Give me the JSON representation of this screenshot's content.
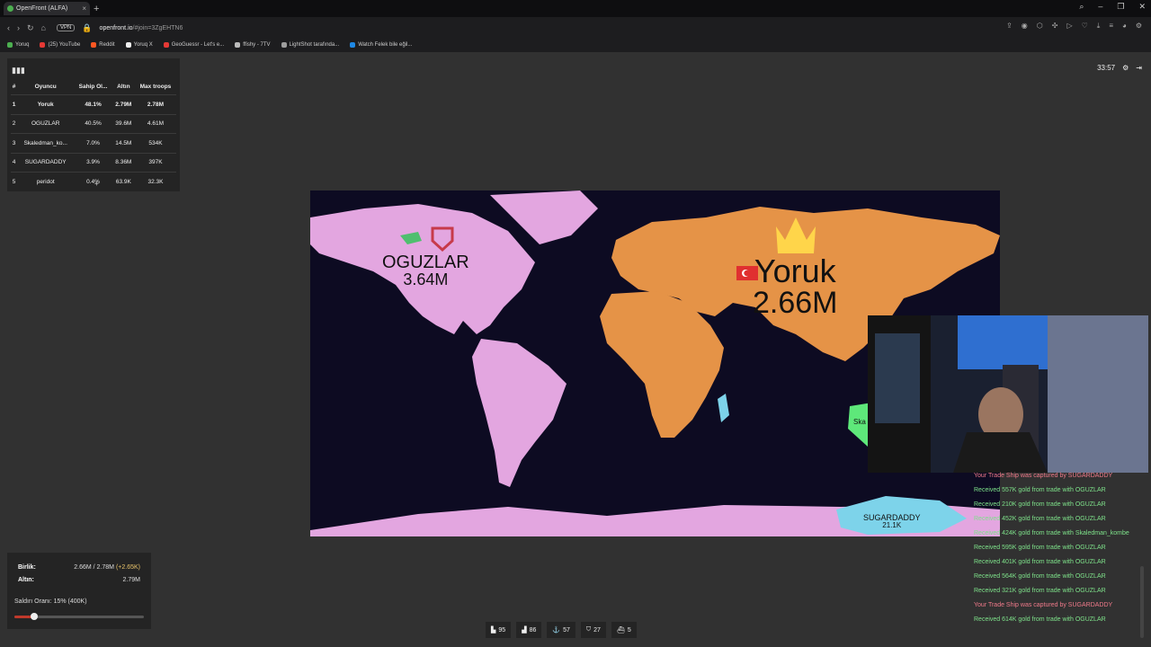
{
  "browser": {
    "tab_title": "OpenFront (ALFA)",
    "url": "openfront.io",
    "url_rest": "/#join=3ZgEHTN6",
    "vpn_label": "VPN",
    "bookmarks": [
      "Yoruq",
      "(25) YouTube",
      "Reddit",
      "Yoruq X",
      "GeoGuessr - Let's e...",
      "ffishy - 7TV",
      "LightShot tarafında...",
      "Watch Felek bile eğil..."
    ],
    "bookmark_colors": [
      "#4caf50",
      "#e53935",
      "#ff5722",
      "#eeeeee",
      "#e53935",
      "#bbbbbb",
      "#9e9e9e",
      "#1e88e5"
    ]
  },
  "leaderboard": {
    "headers": [
      "#",
      "Oyuncu",
      "Sahip Ol...",
      "Altın",
      "Max troops"
    ],
    "rows": [
      {
        "rank": "1",
        "player": "Yoruk",
        "owned": "48.1%",
        "gold": "2.79M",
        "troops": "2.78M"
      },
      {
        "rank": "2",
        "player": "OGUZLAR",
        "owned": "40.5%",
        "gold": "39.6M",
        "troops": "4.61M"
      },
      {
        "rank": "3",
        "player": "Skaledman_ko...",
        "owned": "7.0%",
        "gold": "14.5M",
        "troops": "534K"
      },
      {
        "rank": "4",
        "player": "SUGARDADDY",
        "owned": "3.9%",
        "gold": "8.36M",
        "troops": "397K"
      },
      {
        "rank": "5",
        "player": "peridot",
        "owned": "0.4%",
        "gold": "63.9K",
        "troops": "32.3K"
      }
    ],
    "expand_label": "+"
  },
  "timer": "33:57",
  "map": {
    "labels": [
      {
        "name": "OGUZLAR",
        "value": "3.64M"
      },
      {
        "name": "Yoruk",
        "value": "2.66M"
      },
      {
        "name": "SUGARDADDY",
        "value": "21.1K"
      },
      {
        "name": "Ska",
        "value": ""
      }
    ],
    "colors": {
      "ocean": "#0d0b22",
      "oguzlar": "#e3a6e0",
      "yoruk": "#e59347",
      "sugardaddy": "#7dd3ea",
      "skaledman": "#5ee87a"
    }
  },
  "stats": {
    "troops_label": "Birlik:",
    "troops_value": "2.66M / 2.78M",
    "troops_rate": "(+2.65K)",
    "gold_label": "Altın:",
    "gold_value": "2.79M",
    "attack_ratio_label": "Saldırı Oranı: 15% (400K)",
    "attack_ratio": 0.15
  },
  "bottom_bar": [
    {
      "icon": "city-icon",
      "value": "95"
    },
    {
      "icon": "factory-icon",
      "value": "86"
    },
    {
      "icon": "port-icon",
      "value": "57"
    },
    {
      "icon": "defense-icon",
      "value": "27"
    },
    {
      "icon": "warship-icon",
      "value": "5"
    }
  ],
  "events": [
    {
      "text": "Your Trade Ship was captured by SUGARDADDY",
      "type": "bad"
    },
    {
      "text": "Received 557K gold from trade with OGUZLAR",
      "type": "good"
    },
    {
      "text": "Received 210K gold from trade with OGUZLAR",
      "type": "good"
    },
    {
      "text": "Received 452K gold from trade with OGUZLAR",
      "type": "good"
    },
    {
      "text": "Received 424K gold from trade with Skaledman_kombe",
      "type": "good"
    },
    {
      "text": "Received 595K gold from trade with OGUZLAR",
      "type": "good"
    },
    {
      "text": "Received 401K gold from trade with OGUZLAR",
      "type": "good"
    },
    {
      "text": "Received 564K gold from trade with OGUZLAR",
      "type": "good"
    },
    {
      "text": "Received 321K gold from trade with OGUZLAR",
      "type": "good"
    },
    {
      "text": "Your Trade Ship was captured by SUGARDADDY",
      "type": "bad"
    },
    {
      "text": "Received 614K gold from trade with OGUZLAR",
      "type": "good"
    }
  ],
  "event_colors": {
    "good": "#7ee28a",
    "bad": "#f07a8a"
  }
}
